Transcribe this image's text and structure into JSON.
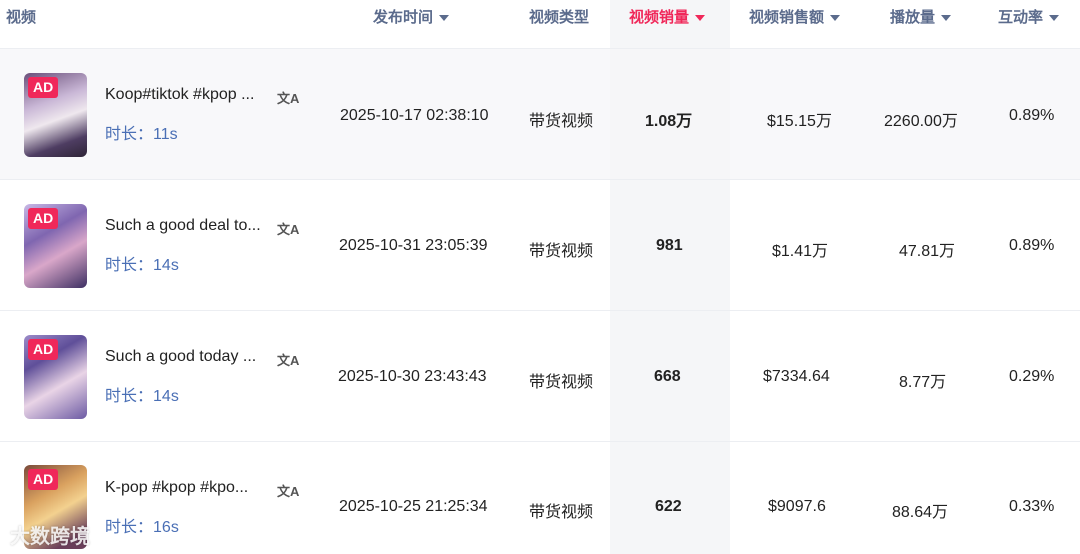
{
  "header": {
    "video": "视频",
    "publish_time": "发布时间",
    "video_type": "视频类型",
    "video_sales": "视频销量",
    "video_revenue": "视频销售额",
    "views": "播放量",
    "engagement": "互动率"
  },
  "ad_badge": "AD",
  "duration_prefix": "时长：",
  "rows": [
    {
      "title": "Koop#tiktok #kpop ...",
      "duration": "11s",
      "publish_time": "2025-10-17 02:38:10",
      "type": "带货视频",
      "sales": "1.08万",
      "revenue": "$15.15万",
      "views": "2260.00万",
      "engagement": "0.89%"
    },
    {
      "title": "Such a good deal to...",
      "duration": "14s",
      "publish_time": "2025-10-31 23:05:39",
      "type": "带货视频",
      "sales": "981",
      "revenue": "$1.41万",
      "views": "47.81万",
      "engagement": "0.89%"
    },
    {
      "title": "Such a good today ...",
      "duration": "14s",
      "publish_time": "2025-10-30 23:43:43",
      "type": "带货视频",
      "sales": "668",
      "revenue": "$7334.64",
      "views": "8.77万",
      "engagement": "0.29%"
    },
    {
      "title": "K-pop #kpop #kpo...",
      "duration": "16s",
      "publish_time": "2025-10-25 21:25:34",
      "type": "带货视频",
      "sales": "622",
      "revenue": "$9097.6",
      "views": "88.64万",
      "engagement": "0.33%"
    }
  ],
  "translate_icon": "文A",
  "watermark": "大数跨境"
}
